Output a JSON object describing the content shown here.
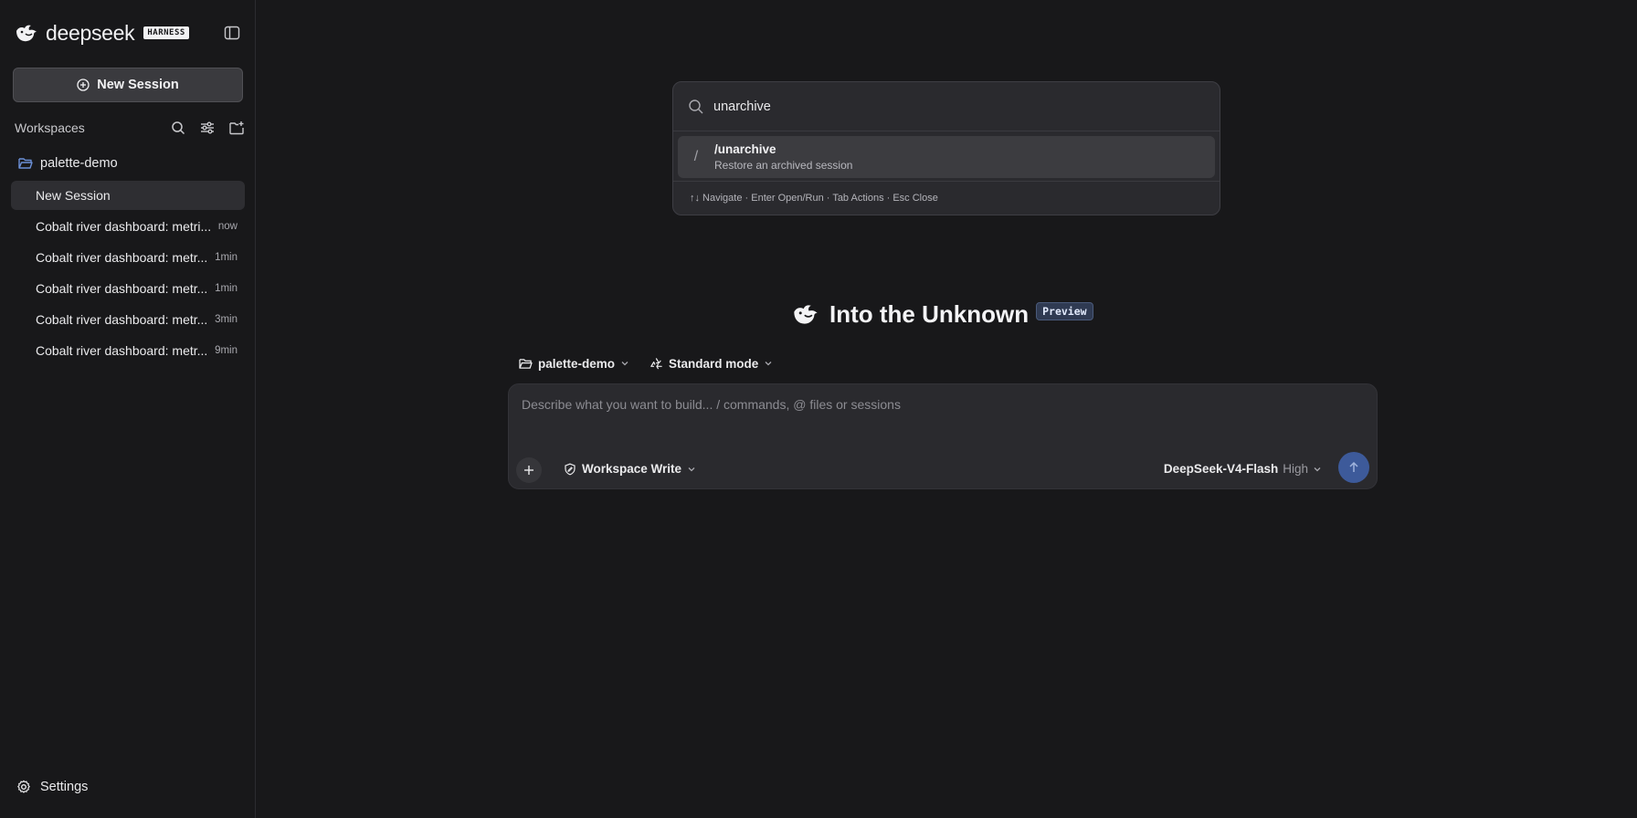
{
  "sidebar": {
    "brand": {
      "name": "deepseek",
      "badge": "HARNESS"
    },
    "new_session_label": "New Session",
    "workspaces_label": "Workspaces",
    "workspace": {
      "name": "palette-demo"
    },
    "sessions": [
      {
        "title": "New Session",
        "time": "",
        "active": true
      },
      {
        "title": "Cobalt river dashboard: metri...",
        "time": "now"
      },
      {
        "title": "Cobalt river dashboard: metr...",
        "time": "1min"
      },
      {
        "title": "Cobalt river dashboard: metr...",
        "time": "1min"
      },
      {
        "title": "Cobalt river dashboard: metr...",
        "time": "3min"
      },
      {
        "title": "Cobalt river dashboard: metr...",
        "time": "9min"
      }
    ],
    "settings_label": "Settings"
  },
  "palette": {
    "query": "unarchive",
    "results": [
      {
        "command": "/unarchive",
        "description": "Restore an archived session"
      }
    ],
    "footer": "↑↓ Navigate · Enter Open/Run · Tab Actions · Esc Close"
  },
  "hero": {
    "title": "Into the Unknown",
    "badge": "Preview"
  },
  "selectors": {
    "workspace": "palette-demo",
    "mode": "Standard mode"
  },
  "composer": {
    "placeholder": "Describe what you want to build... / commands, @ files or sessions",
    "permission": "Workspace Write",
    "model": "DeepSeek-V4-Flash",
    "effort": "High"
  },
  "colors": {
    "accent": "#3d5a9a",
    "background": "#18181a",
    "folder": "#6b8fd6"
  }
}
